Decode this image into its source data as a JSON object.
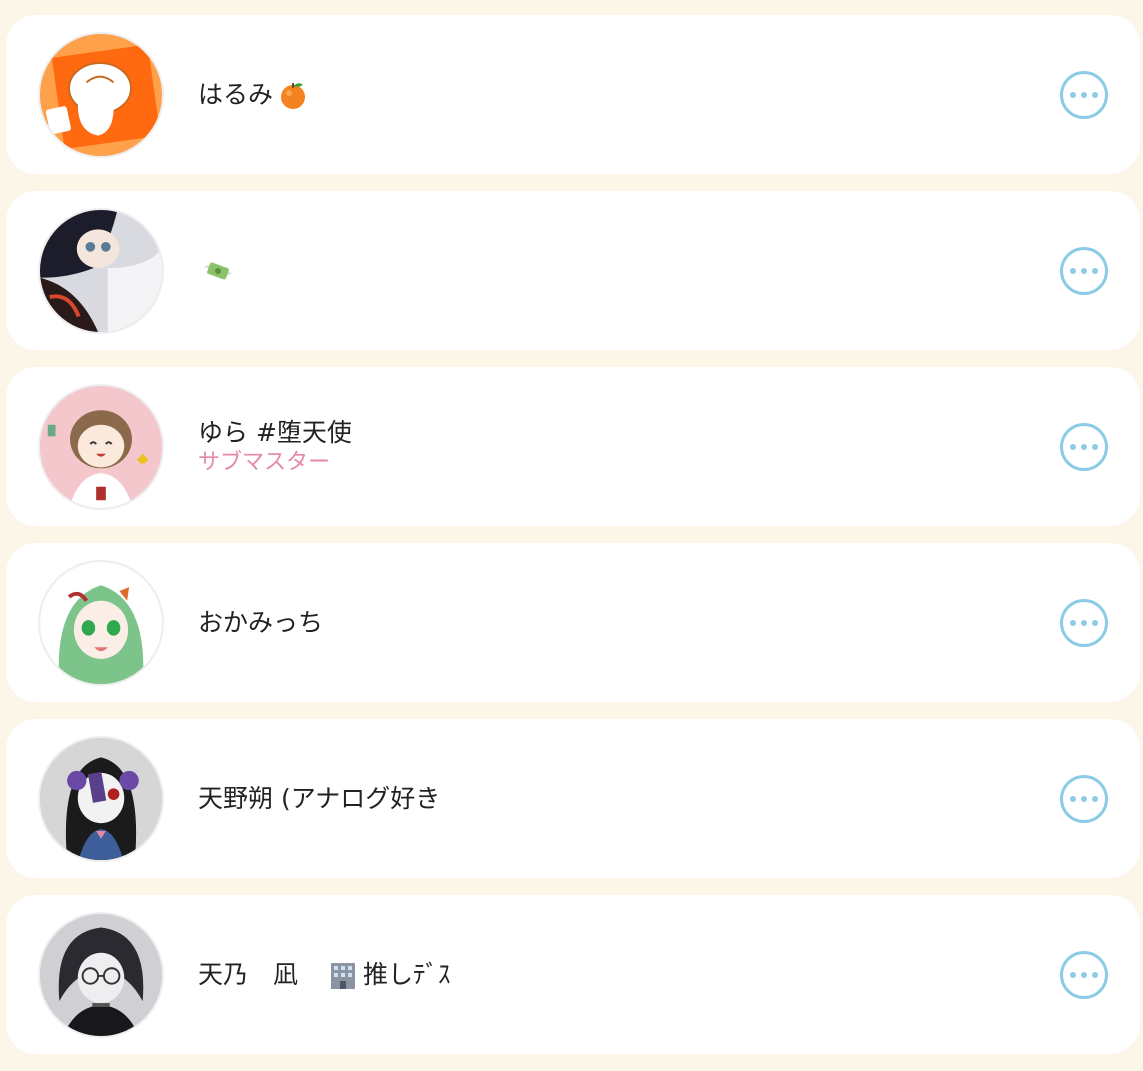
{
  "colors": {
    "page_bg": "#fcf6e8",
    "card_bg": "#ffffff",
    "role_text": "#e58aa6",
    "more_button": "#8ccbe6"
  },
  "members": [
    {
      "name": "はるみ",
      "emoji_icon": "tangerine-icon",
      "avatar_icon": "orange-doodle-avatar",
      "role": ""
    },
    {
      "name": "",
      "emoji_icon": "money-with-wings-icon",
      "avatar_icon": "dark-hair-anime-avatar",
      "role": ""
    },
    {
      "name": "ゆら #堕天使",
      "emoji_icon": "",
      "avatar_icon": "smiling-brown-hair-avatar",
      "role": "サブマスター"
    },
    {
      "name": "おかみっち",
      "emoji_icon": "",
      "avatar_icon": "green-hair-avatar",
      "role": ""
    },
    {
      "name": "天野朔 (アナログ好き",
      "emoji_icon": "",
      "avatar_icon": "monochrome-purple-avatar",
      "role": ""
    },
    {
      "name": "天乃　凪　",
      "emoji_icon": "office-building-icon",
      "name_suffix": "推しﾃﾞｽ",
      "avatar_icon": "glasses-dark-hair-avatar",
      "role": ""
    }
  ]
}
